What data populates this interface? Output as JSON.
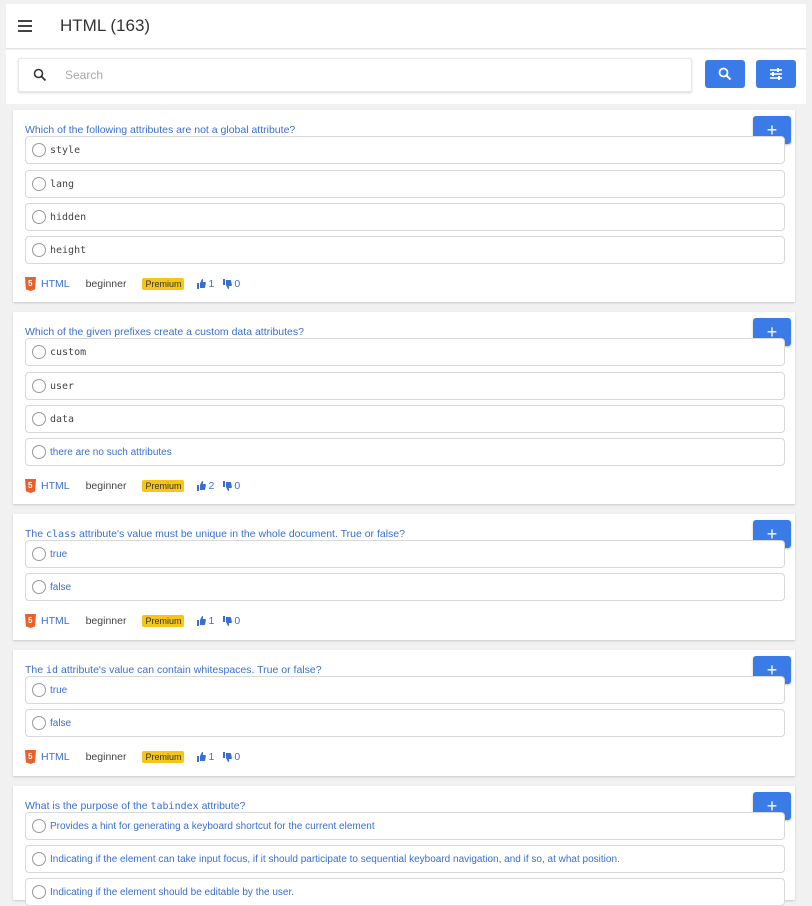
{
  "header": {
    "title": "HTML (163)"
  },
  "search": {
    "placeholder": "Search"
  },
  "questions": [
    {
      "text": "Which of the following attributes are not a global attribute?",
      "options": [
        "style",
        "lang",
        "hidden",
        "height"
      ],
      "tag": "HTML",
      "level": "beginner",
      "badge": "Premium",
      "likes": "1",
      "dislikes": "0"
    },
    {
      "text": "Which of the given prefixes create a custom data attributes?",
      "options": [
        "custom",
        "user",
        "data",
        "there are no such attributes"
      ],
      "tag": "HTML",
      "level": "beginner",
      "badge": "Premium",
      "likes": "2",
      "dislikes": "0"
    },
    {
      "text_pre": "The ",
      "text_code": "class",
      "text_post": " attribute's value must be unique in the whole document. True or false?",
      "options": [
        "true",
        "false"
      ],
      "tag": "HTML",
      "level": "beginner",
      "badge": "Premium",
      "likes": "1",
      "dislikes": "0"
    },
    {
      "text_pre": "The ",
      "text_code": "id",
      "text_post": " attribute's value can contain whitespaces. True or false?",
      "options": [
        "true",
        "false"
      ],
      "tag": "HTML",
      "level": "beginner",
      "badge": "Premium",
      "likes": "1",
      "dislikes": "0"
    },
    {
      "text_pre": "What is the purpose of the ",
      "text_code": "tabindex",
      "text_post": " attribute?",
      "options": [
        "Provides a hint for generating a keyboard shortcut for the current element",
        "Indicating if the element can take input focus, if it should participate to sequential keyboard navigation, and if so, at what position.",
        "Indicating if the element should be editable by the user."
      ]
    }
  ],
  "colors": {
    "accent": "#3b7be8",
    "link": "#3a6fcf",
    "premium": "#f5c518",
    "html_badge": "#e8612c"
  },
  "icons": {
    "menu": "hamburger-icon",
    "search": "search-icon",
    "filter": "sliders-icon",
    "add": "plus-icon",
    "like": "thumbs-up-icon",
    "dislike": "thumbs-down-icon",
    "tag": "html5-icon"
  }
}
